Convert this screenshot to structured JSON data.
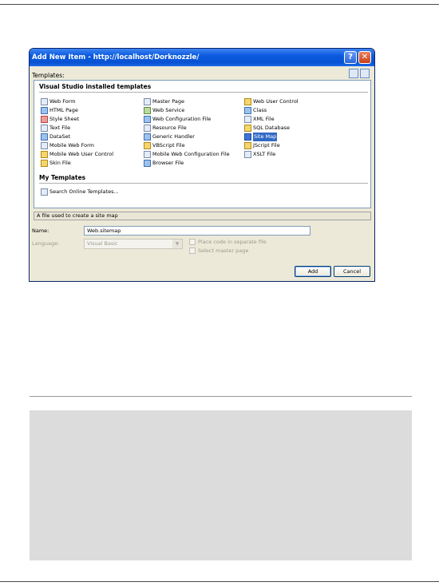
{
  "dialog": {
    "title": "Add New Item - http://localhost/Dorknozzle/",
    "templates_label": "Templates:",
    "groups": {
      "installed": "Visual Studio installed templates",
      "mine": "My Templates"
    },
    "templates": {
      "col1": [
        "Web Form",
        "HTML Page",
        "Style Sheet",
        "Text File",
        "DataSet",
        "Mobile Web Form",
        "Mobile Web User Control",
        "Skin File"
      ],
      "col2": [
        "Master Page",
        "Web Service",
        "Web Configuration File",
        "Resource File",
        "Generic Handler",
        "VBScript File",
        "Mobile Web Configuration File",
        "Browser File"
      ],
      "col3": [
        "Web User Control",
        "Class",
        "XML File",
        "SQL Database",
        "Site Map",
        "JScript File",
        "XSLT File"
      ]
    },
    "my_templates": [
      "Search Online Templates..."
    ],
    "selected_template": "Site Map",
    "status_text": "A file used to create a site map",
    "name_label": "Name:",
    "name_value": "Web.sitemap",
    "language_label": "Language:",
    "language_value": "Visual Basic",
    "checkbox_place_code": "Place code in separate file",
    "checkbox_master_page": "Select master page",
    "add_button": "Add",
    "cancel_button": "Cancel"
  }
}
